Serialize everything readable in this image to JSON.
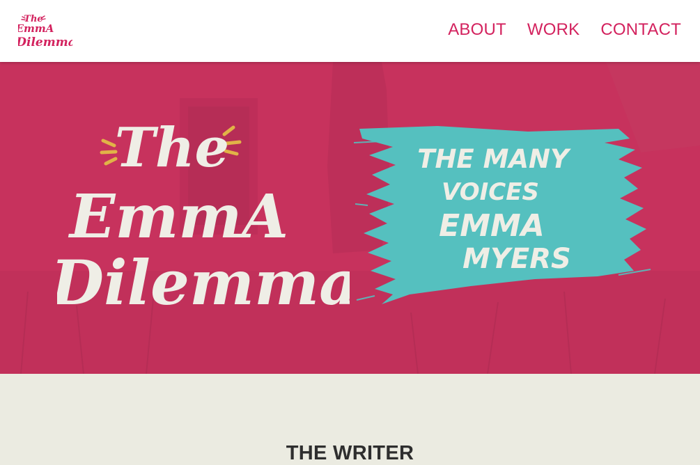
{
  "brand": {
    "logo_line1": "The",
    "logo_line2": "EmmA",
    "logo_line3": "Dilemma",
    "logo_color": "#d3225e"
  },
  "nav": {
    "items": [
      {
        "label": "ABOUT"
      },
      {
        "label": "WORK"
      },
      {
        "label": "CONTACT"
      }
    ],
    "color": "#d3225e"
  },
  "hero": {
    "title_line1": "The",
    "title_line2": "EmmA",
    "title_line3": "Dilemma",
    "tagline_line1": "THE MANY",
    "tagline_line2": "VOICES",
    "tagline_line3": "EMMA",
    "tagline_line4": "MYERS",
    "background_color": "#c7325d",
    "title_color": "#efeee6",
    "accent_color": "#e1b347",
    "brush_color": "#55c0bf"
  },
  "section": {
    "heading": "THE WRITER",
    "background_color": "#ebebe1"
  }
}
